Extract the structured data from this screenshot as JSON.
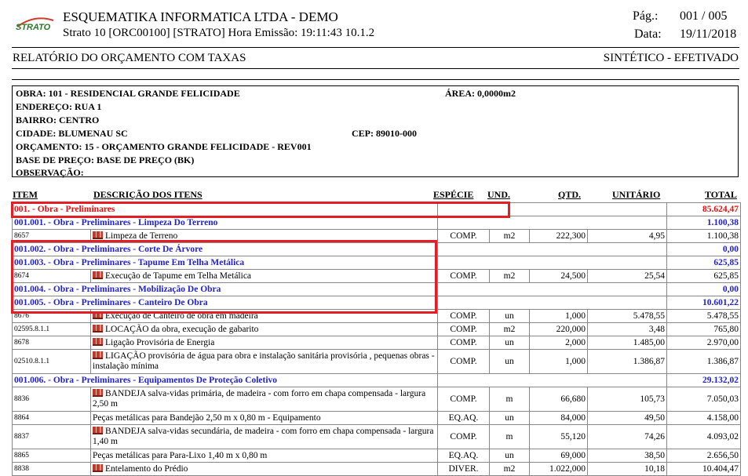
{
  "header": {
    "logo_text": "STRATO",
    "company": "ESQUEMATIKA INFORMATICA LTDA - DEMO",
    "system_line": "Strato 10 [ORC00100] [STRATO] Hora Emissão: 19:11:43  10.1.2",
    "page_label": "Pág.:",
    "page_value": "001   / 005",
    "date_label": "Data:",
    "date_value": "19/11/2018"
  },
  "report": {
    "title": "RELATÓRIO DO ORÇAMENTO COM TAXAS",
    "subtitle": "SINTÉTICO - EFETIVADO"
  },
  "obra": {
    "obra": "OBRA: 101 - RESIDENCIAL GRANDE FELICIDADE",
    "area": "ÁREA: 0,0000m2",
    "endereco": "ENDEREÇO: RUA 1",
    "bairro": "BAIRRO: CENTRO",
    "cidade": "CIDADE: BLUMENAU SC",
    "cep": "CEP: 89010-000",
    "orcamento": "ORÇAMENTO: 15 - ORÇAMENTO GRANDE FELICIDADE - REV001",
    "base": "BASE DE PREÇO: BASE DE PREÇO (BK)",
    "observacao": "OBSERVAÇÃO:"
  },
  "columns": {
    "item": "ITEM",
    "descricao": "DESCRIÇÃO DOS ITENS",
    "especie": "ESPÉCIE",
    "und": "UND.",
    "qtd": "QTD.",
    "unitario": "UNITÁRIO",
    "total": "TOTAL"
  },
  "rows": [
    {
      "type": "g1",
      "label": "001. - Obra - Preliminares",
      "total": "85.624,47"
    },
    {
      "type": "g",
      "label": "001.001. - Obra - Preliminares - Limpeza Do Terreno",
      "total": "1.100,38"
    },
    {
      "type": "i",
      "code": "8657",
      "desc": "Limpeza de Terreno",
      "esp": "COMP.",
      "und": "m2",
      "qtd": "222,300",
      "unit": "4,95",
      "total": "1.100,38"
    },
    {
      "type": "g",
      "label": "001.002. - Obra - Preliminares - Corte De Árvore",
      "total": "0,00"
    },
    {
      "type": "g",
      "label": "001.003. - Obra - Preliminares - Tapume Em Telha Metálica",
      "total": "625,85"
    },
    {
      "type": "i",
      "code": "8674",
      "desc": "Execução de Tapume em Telha Metálica",
      "esp": "COMP.",
      "und": "m2",
      "qtd": "24,500",
      "unit": "25,54",
      "total": "625,85"
    },
    {
      "type": "g",
      "label": "001.004. - Obra - Preliminares - Mobilização De Obra",
      "total": "0,00"
    },
    {
      "type": "g",
      "label": "001.005. - Obra - Preliminares - Canteiro De Obra",
      "total": "10.601,22"
    },
    {
      "type": "i",
      "code": "8676",
      "desc": "Execução de Canteiro de obra em madeira",
      "esp": "COMP.",
      "und": "un",
      "qtd": "1,000",
      "unit": "5.478,55",
      "total": "5.478,55"
    },
    {
      "type": "i",
      "code": "02595.8.1.1",
      "desc": "LOCAÇÃO da obra, execução de gabarito",
      "esp": "COMP.",
      "und": "m2",
      "qtd": "220,000",
      "unit": "3,48",
      "total": "765,80"
    },
    {
      "type": "i",
      "code": "8678",
      "desc": "Ligação Provisória de Energia",
      "esp": "COMP.",
      "und": "un",
      "qtd": "2,000",
      "unit": "1.485,00",
      "total": "2.970,00"
    },
    {
      "type": "t",
      "code": "02510.8.1.1",
      "desc": "LIGAÇÃO provisória de água para obra e instalação sanitária provisória , pequenas obras - instalação mínima",
      "esp": "COMP.",
      "und": "un",
      "qtd": "1,000",
      "unit": "1.386,87",
      "total": "1.386,87"
    },
    {
      "type": "g",
      "label": "001.006. - Obra - Preliminares - Equipamentos De Proteção Coletivo",
      "total": "29.132,02"
    },
    {
      "type": "t",
      "code": "8836",
      "desc": "BANDEJA salva-vidas primária, de madeira - com forro em chapa compensada - largura 2,50 m",
      "esp": "COMP.",
      "und": "m",
      "qtd": "66,680",
      "unit": "105,73",
      "total": "7.050,03"
    },
    {
      "type": "p",
      "code": "8864",
      "desc": "Peças metálicas para Bandejão 2,50 m x 0,80 m - Equipamento",
      "esp": "EQ.AQ.",
      "und": "un",
      "qtd": "84,000",
      "unit": "49,50",
      "total": "4.158,00"
    },
    {
      "type": "t",
      "code": "8837",
      "desc": "BANDEJA salva-vidas secundária, de madeira - com forro em chapa compensada - largura 1,40 m",
      "esp": "COMP.",
      "und": "m",
      "qtd": "55,120",
      "unit": "74,26",
      "total": "4.093,02"
    },
    {
      "type": "p",
      "code": "8865",
      "desc": "Peças metálicas para Para-Lixo 1,40 m x 0,80 m",
      "esp": "EQ.AQ.",
      "und": "un",
      "qtd": "69,000",
      "unit": "38,50",
      "total": "2.656,50"
    },
    {
      "type": "i",
      "code": "8838",
      "desc": "Entelamento do Prédio",
      "esp": "DIVER.",
      "und": "m2",
      "qtd": "1.022,000",
      "unit": "10,18",
      "total": "10.404,47"
    }
  ]
}
